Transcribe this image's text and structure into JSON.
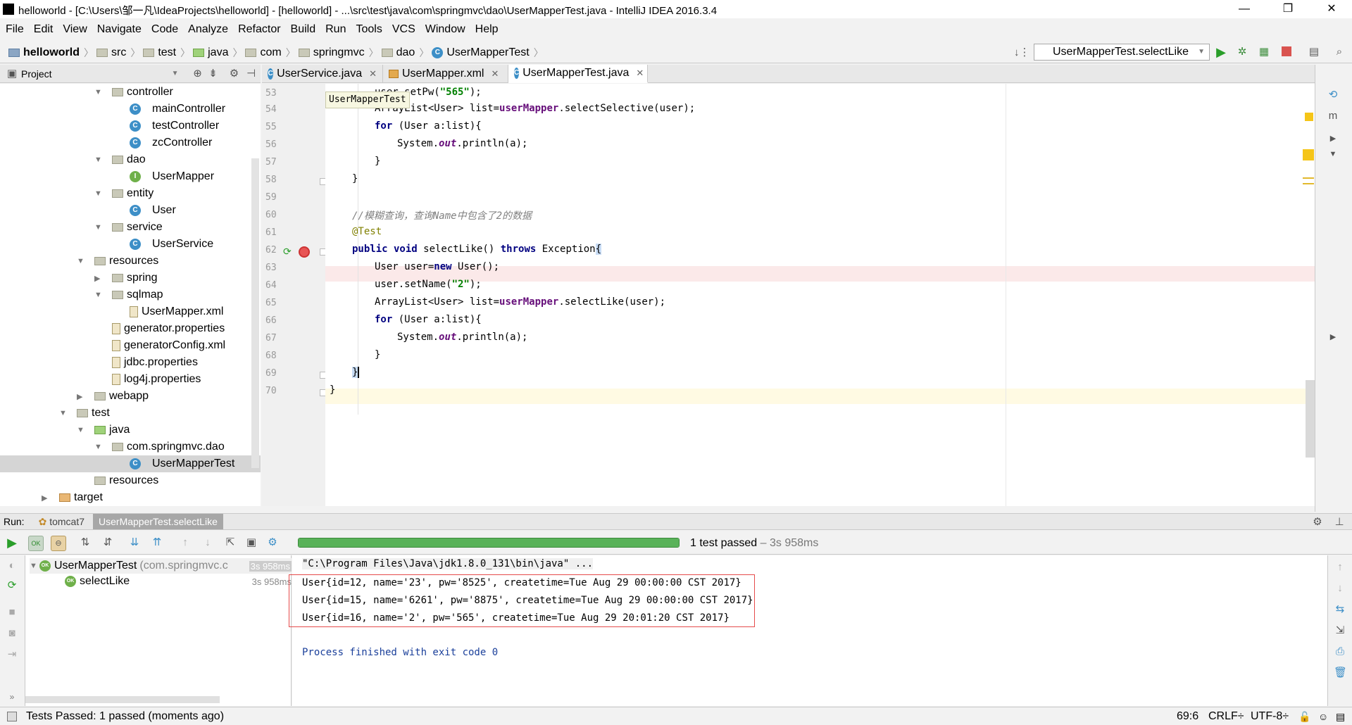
{
  "window": {
    "title": "helloworld - [C:\\Users\\邹一凡\\IdeaProjects\\helloworld] - [helloworld] - ...\\src\\test\\java\\com\\springmvc\\dao\\UserMapperTest.java - IntelliJ IDEA 2016.3.4",
    "minimize": "—",
    "restore": "❐",
    "close": "✕"
  },
  "menu": [
    "File",
    "Edit",
    "View",
    "Navigate",
    "Code",
    "Analyze",
    "Refactor",
    "Build",
    "Run",
    "Tools",
    "VCS",
    "Window",
    "Help"
  ],
  "breadcrumbs": [
    "helloworld",
    "src",
    "test",
    "java",
    "com",
    "springmvc",
    "dao",
    "UserMapperTest"
  ],
  "run_config": "UserMapperTest.selectLike",
  "project_panel": {
    "title": "Project",
    "tree": [
      {
        "label": "controller",
        "type": "folder",
        "indent": 1,
        "arrow": "▼"
      },
      {
        "label": "mainController",
        "type": "class",
        "indent": 2
      },
      {
        "label": "testController",
        "type": "class",
        "indent": 2
      },
      {
        "label": "zcController",
        "type": "class",
        "indent": 2
      },
      {
        "label": "dao",
        "type": "folder",
        "indent": 1,
        "arrow": "▼"
      },
      {
        "label": "UserMapper",
        "type": "interface",
        "indent": 2
      },
      {
        "label": "entity",
        "type": "folder",
        "indent": 1,
        "arrow": "▼"
      },
      {
        "label": "User",
        "type": "class",
        "indent": 2
      },
      {
        "label": "service",
        "type": "folder",
        "indent": 1,
        "arrow": "▼"
      },
      {
        "label": "UserService",
        "type": "class",
        "indent": 2
      },
      {
        "label": "resources",
        "type": "folder",
        "indent": 0,
        "arrow": "▼"
      },
      {
        "label": "spring",
        "type": "folder",
        "indent": 1,
        "arrow": "▶"
      },
      {
        "label": "sqlmap",
        "type": "folder",
        "indent": 1,
        "arrow": "▼"
      },
      {
        "label": "UserMapper.xml",
        "type": "file",
        "indent": 2
      },
      {
        "label": "generator.properties",
        "type": "file",
        "indent": 1
      },
      {
        "label": "generatorConfig.xml",
        "type": "file",
        "indent": 1
      },
      {
        "label": "jdbc.properties",
        "type": "file",
        "indent": 1
      },
      {
        "label": "log4j.properties",
        "type": "file",
        "indent": 1
      },
      {
        "label": "webapp",
        "type": "folder",
        "indent": 0,
        "arrow": "▶"
      },
      {
        "label": "test",
        "type": "folder",
        "indent": -1,
        "arrow": "▼"
      },
      {
        "label": "java",
        "type": "folder-green",
        "indent": 0,
        "arrow": "▼"
      },
      {
        "label": "com.springmvc.dao",
        "type": "folder",
        "indent": 1,
        "arrow": "▼"
      },
      {
        "label": "UserMapperTest",
        "type": "class",
        "indent": 2,
        "selected": true
      },
      {
        "label": "resources",
        "type": "folder",
        "indent": 0
      },
      {
        "label": "target",
        "type": "folder-orange",
        "indent": -2,
        "arrow": "▶"
      }
    ]
  },
  "editor": {
    "tabs": [
      {
        "label": "UserService.java",
        "active": false
      },
      {
        "label": "UserMapper.xml",
        "active": false
      },
      {
        "label": "UserMapperTest.java",
        "active": true
      }
    ],
    "tooltip": "UserMapperTest",
    "line_numbers": [
      "53",
      "54",
      "55",
      "56",
      "57",
      "58",
      "59",
      "60",
      "61",
      "62",
      "63",
      "64",
      "65",
      "66",
      "67",
      "68",
      "69",
      "70"
    ]
  },
  "run_panel": {
    "label": "Run:",
    "tabs": [
      "tomcat7",
      "UserMapperTest.selectLike"
    ],
    "status": "1 test passed",
    "duration": "3s 958ms",
    "progress": 1.0,
    "tests": [
      {
        "name": "UserMapperTest",
        "detail": "(com.springmvc.c",
        "time": "3s 958ms"
      },
      {
        "name": "selectLike",
        "detail": "",
        "time": "3s 958ms"
      }
    ],
    "console": {
      "command": "\"C:\\Program Files\\Java\\jdk1.8.0_131\\bin\\java\" ...",
      "lines": [
        "User{id=12, name='23', pw='8525', createtime=Tue Aug 29 00:00:00 CST 2017}",
        "User{id=15, name='6261', pw='8875', createtime=Tue Aug 29 00:00:00 CST 2017}",
        "User{id=16, name='2', pw='565', createtime=Tue Aug 29 20:01:20 CST 2017}"
      ],
      "exit": "Process finished with exit code 0"
    }
  },
  "statusbar": {
    "message": "Tests Passed: 1 passed (moments ago)",
    "position": "69:6",
    "line_sep": "CRLF÷",
    "encoding": "UTF-8÷"
  }
}
